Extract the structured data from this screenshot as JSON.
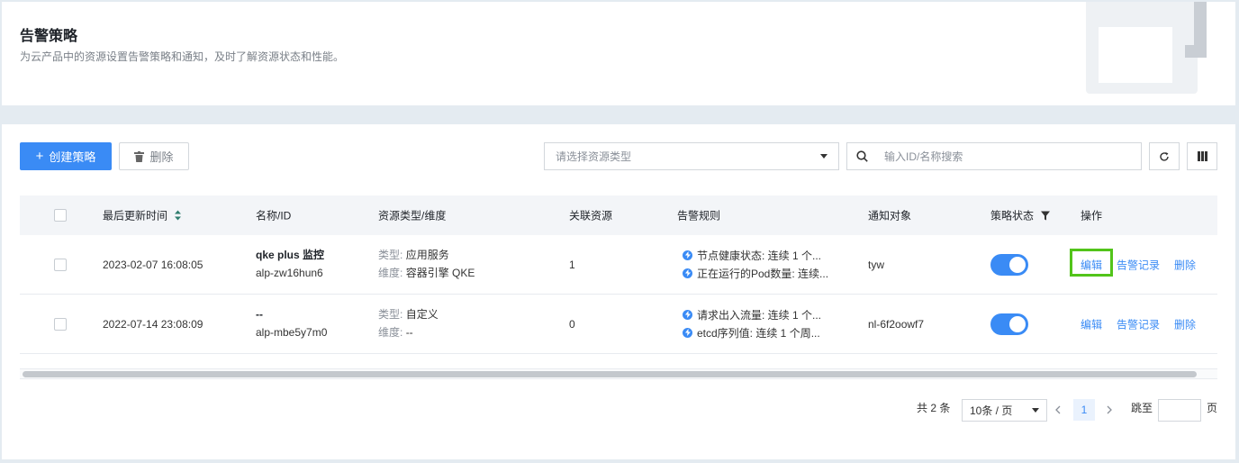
{
  "header": {
    "title": "告警策略",
    "description": "为云产品中的资源设置告警策略和通知，及时了解资源状态和性能。"
  },
  "toolbar": {
    "create_label": "创建策略",
    "delete_label": "删除",
    "resource_type_placeholder": "请选择资源类型",
    "search_placeholder": "输入ID/名称搜索"
  },
  "table": {
    "columns": [
      "最后更新时间",
      "名称/ID",
      "资源类型/维度",
      "关联资源",
      "告警规则",
      "通知对象",
      "策略状态",
      "操作"
    ],
    "type_prefix": "类型:",
    "dimension_prefix": "维度:",
    "rows": [
      {
        "updated": "2023-02-07 16:08:05",
        "name": "qke plus 监控",
        "id": "alp-zw16hun6",
        "type": "应用服务",
        "dimension": "容器引擎 QKE",
        "resources": "1",
        "rules": [
          "节点健康状态: 连续 1 个...",
          "正在运行的Pod数量: 连续..."
        ],
        "notify": "tyw",
        "enabled": true
      },
      {
        "updated": "2022-07-14 23:08:09",
        "name": "--",
        "id": "alp-mbe5y7m0",
        "type": "自定义",
        "dimension": "--",
        "resources": "0",
        "rules": [
          "请求出入流量: 连续 1 个...",
          "etcd序列值: 连续 1 个周..."
        ],
        "notify": "nl-6f2oowf7",
        "enabled": true
      }
    ],
    "actions": {
      "edit": "编辑",
      "records": "告警记录",
      "delete": "删除"
    }
  },
  "pagination": {
    "total": "共 2 条",
    "page_size": "10条 / 页",
    "current_page": "1",
    "jump_label": "跳至",
    "page_suffix": "页"
  },
  "colors": {
    "accent": "#3a8bf5",
    "highlight": "#52c41a"
  }
}
